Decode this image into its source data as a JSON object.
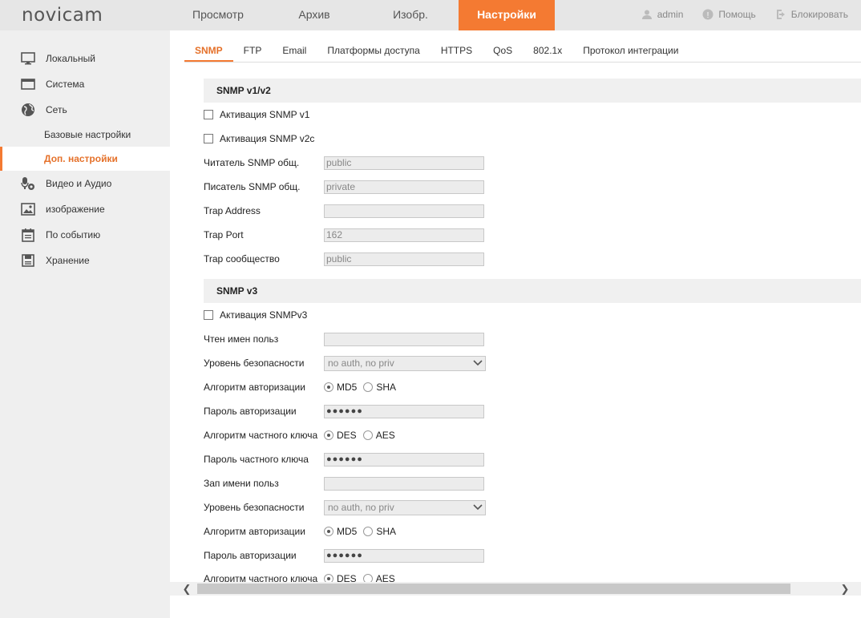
{
  "app": {
    "logo": "novicam"
  },
  "topnav": [
    {
      "label": "Просмотр"
    },
    {
      "label": "Архив"
    },
    {
      "label": "Изобр."
    },
    {
      "label": "Настройки"
    }
  ],
  "topright": {
    "user": "admin",
    "help": "Помощь",
    "lock": "Блокировать"
  },
  "sidebar": {
    "items": [
      {
        "label": "Локальный",
        "icon": "monitor-icon"
      },
      {
        "label": "Система",
        "icon": "window-icon"
      },
      {
        "label": "Сеть",
        "icon": "globe-icon"
      }
    ],
    "sub": [
      {
        "label": "Базовые настройки"
      },
      {
        "label": "Доп. настройки"
      }
    ],
    "items2": [
      {
        "label": "Видео и Аудио",
        "icon": "mic-camera-icon"
      },
      {
        "label": "изображение",
        "icon": "image-icon"
      },
      {
        "label": "По событию",
        "icon": "calendar-icon"
      },
      {
        "label": "Хранение",
        "icon": "disk-icon"
      }
    ]
  },
  "subtabs": [
    {
      "label": "SNMP"
    },
    {
      "label": "FTP"
    },
    {
      "label": "Email"
    },
    {
      "label": "Платформы доступа"
    },
    {
      "label": "HTTPS"
    },
    {
      "label": "QoS"
    },
    {
      "label": "802.1x"
    },
    {
      "label": "Протокол интеграции"
    }
  ],
  "v12": {
    "title": "SNMP v1/v2",
    "enable_v1": "Активация SNMP v1",
    "enable_v2c": "Активация SNMP v2c",
    "read_label": "Читатель SNMP общ.",
    "read_value": "public",
    "write_label": "Писатель SNMP общ.",
    "write_value": "private",
    "trap_addr_label": "Trap Address",
    "trap_addr_value": "",
    "trap_port_label": "Trap Port",
    "trap_port_value": "162",
    "trap_comm_label": "Trap сообщество",
    "trap_comm_value": "public"
  },
  "v3": {
    "title": "SNMP v3",
    "enable": "Активация SNMPv3",
    "read_user_label": "Чтен имен польз",
    "sec_label": "Уровень безопасности",
    "sec_value": "no auth, no priv",
    "auth_alg_label": "Алгоритм авторизации",
    "md5": "MD5",
    "sha": "SHA",
    "auth_pw_label": "Пароль авторизации",
    "pw_mask": "●●●●●●",
    "priv_alg_label": "Алгоритм частного ключа",
    "des": "DES",
    "aes": "AES",
    "priv_pw_label": "Пароль частного ключа",
    "write_user_label": "Зап имени польз"
  },
  "colors": {
    "accent": "#f47a32"
  }
}
